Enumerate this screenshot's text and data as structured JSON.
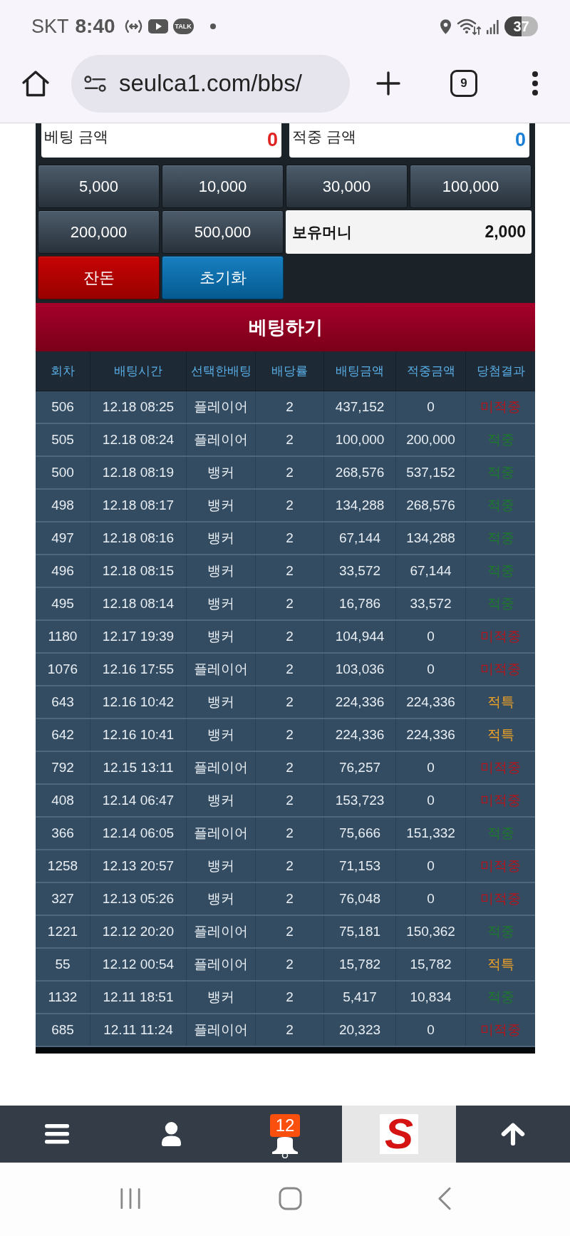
{
  "status_bar": {
    "carrier": "SKT",
    "time": "8:40",
    "talk_badge": "TALK",
    "battery": "37"
  },
  "browser": {
    "url": "seulca1.com/bbs/",
    "tab_count": "9"
  },
  "bet_form": {
    "bet_amount": {
      "label": "베팅 금액",
      "value": "0"
    },
    "win_amount": {
      "label": "적중 금액",
      "value": "0"
    },
    "chips": [
      "5,000",
      "10,000",
      "30,000",
      "100,000",
      "200,000",
      "500,000"
    ],
    "balance": {
      "label": "보유머니",
      "value": "2,000"
    },
    "actions": [
      {
        "label": "잔돈",
        "kind": "change"
      },
      {
        "label": "초기화",
        "kind": "reset"
      }
    ],
    "submit": "베팅하기"
  },
  "table": {
    "columns": [
      "회차",
      "배팅시간",
      "선택한배팅",
      "배당률",
      "배팅금액",
      "적중금액",
      "당첨결과"
    ],
    "rows": [
      {
        "round": "506",
        "time": "12.18 08:25",
        "pick": "플레이어",
        "odds": "2",
        "bet": "437,152",
        "win": "0",
        "result": "미적중",
        "color": "#b3141c"
      },
      {
        "round": "505",
        "time": "12.18 08:24",
        "pick": "플레이어",
        "odds": "2",
        "bet": "100,000",
        "win": "200,000",
        "result": "적중",
        "color": "#1d7a2b"
      },
      {
        "round": "500",
        "time": "12.18 08:19",
        "pick": "뱅커",
        "odds": "2",
        "bet": "268,576",
        "win": "537,152",
        "result": "적중",
        "color": "#1d7a2b"
      },
      {
        "round": "498",
        "time": "12.18 08:17",
        "pick": "뱅커",
        "odds": "2",
        "bet": "134,288",
        "win": "268,576",
        "result": "적중",
        "color": "#1d7a2b"
      },
      {
        "round": "497",
        "time": "12.18 08:16",
        "pick": "뱅커",
        "odds": "2",
        "bet": "67,144",
        "win": "134,288",
        "result": "적중",
        "color": "#1d7a2b"
      },
      {
        "round": "496",
        "time": "12.18 08:15",
        "pick": "뱅커",
        "odds": "2",
        "bet": "33,572",
        "win": "67,144",
        "result": "적중",
        "color": "#1d7a2b"
      },
      {
        "round": "495",
        "time": "12.18 08:14",
        "pick": "뱅커",
        "odds": "2",
        "bet": "16,786",
        "win": "33,572",
        "result": "적중",
        "color": "#1d7a2b"
      },
      {
        "round": "1180",
        "time": "12.17 19:39",
        "pick": "뱅커",
        "odds": "2",
        "bet": "104,944",
        "win": "0",
        "result": "미적중",
        "color": "#b3141c"
      },
      {
        "round": "1076",
        "time": "12.16 17:55",
        "pick": "플레이어",
        "odds": "2",
        "bet": "103,036",
        "win": "0",
        "result": "미적중",
        "color": "#b3141c"
      },
      {
        "round": "643",
        "time": "12.16 10:42",
        "pick": "뱅커",
        "odds": "2",
        "bet": "224,336",
        "win": "224,336",
        "result": "적특",
        "color": "#f0a325"
      },
      {
        "round": "642",
        "time": "12.16 10:41",
        "pick": "뱅커",
        "odds": "2",
        "bet": "224,336",
        "win": "224,336",
        "result": "적특",
        "color": "#f0a325"
      },
      {
        "round": "792",
        "time": "12.15 13:11",
        "pick": "플레이어",
        "odds": "2",
        "bet": "76,257",
        "win": "0",
        "result": "미적중",
        "color": "#b3141c"
      },
      {
        "round": "408",
        "time": "12.14 06:47",
        "pick": "뱅커",
        "odds": "2",
        "bet": "153,723",
        "win": "0",
        "result": "미적중",
        "color": "#b3141c"
      },
      {
        "round": "366",
        "time": "12.14 06:05",
        "pick": "플레이어",
        "odds": "2",
        "bet": "75,666",
        "win": "151,332",
        "result": "적중",
        "color": "#1d7a2b"
      },
      {
        "round": "1258",
        "time": "12.13 20:57",
        "pick": "뱅커",
        "odds": "2",
        "bet": "71,153",
        "win": "0",
        "result": "미적중",
        "color": "#b3141c"
      },
      {
        "round": "327",
        "time": "12.13 05:26",
        "pick": "뱅커",
        "odds": "2",
        "bet": "76,048",
        "win": "0",
        "result": "미적중",
        "color": "#b3141c"
      },
      {
        "round": "1221",
        "time": "12.12 20:20",
        "pick": "플레이어",
        "odds": "2",
        "bet": "75,181",
        "win": "150,362",
        "result": "적중",
        "color": "#1d7a2b"
      },
      {
        "round": "55",
        "time": "12.12 00:54",
        "pick": "플레이어",
        "odds": "2",
        "bet": "15,782",
        "win": "15,782",
        "result": "적특",
        "color": "#f0a325"
      },
      {
        "round": "1132",
        "time": "12.11 18:51",
        "pick": "뱅커",
        "odds": "2",
        "bet": "5,417",
        "win": "10,834",
        "result": "적중",
        "color": "#1d7a2b"
      },
      {
        "round": "685",
        "time": "12.11 11:24",
        "pick": "플레이어",
        "odds": "2",
        "bet": "20,323",
        "win": "0",
        "result": "미적중",
        "color": "#b3141c"
      }
    ]
  },
  "bottom_nav": {
    "notification_count": "12",
    "logo": "S"
  }
}
